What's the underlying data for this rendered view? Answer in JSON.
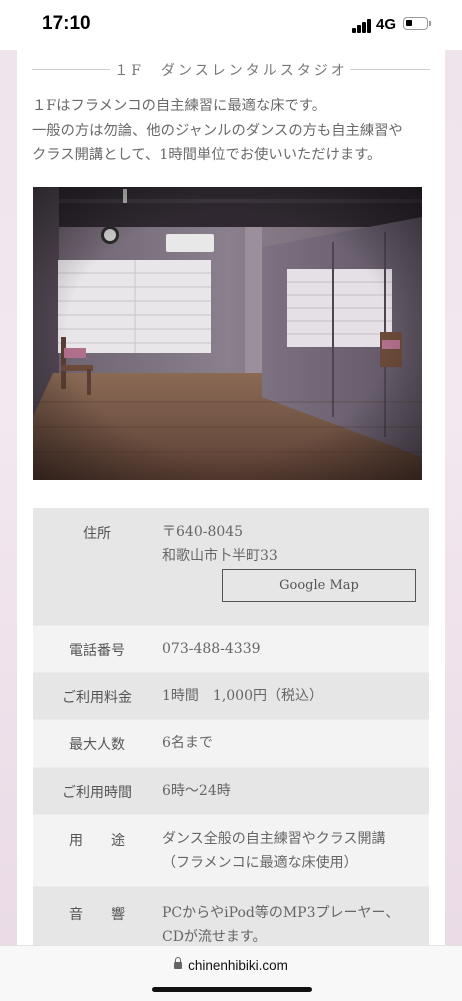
{
  "status_bar": {
    "time": "17:10",
    "network": "4G",
    "battery_level": 0.25
  },
  "section": {
    "heading": "１F　ダンスレンタルスタジオ",
    "intro_lines": [
      "１Fはフラメンコの自主練習に最適な床です。",
      "一般の方は勿論、他のジャンルのダンスの方も自主練習や",
      "クラス開講として、1時間単位でお使いいただけます。"
    ]
  },
  "info": {
    "address": {
      "label": "住所",
      "postal": "〒640-8045",
      "street": "和歌山市卜半町33",
      "map_button": "Google Map"
    },
    "phone": {
      "label": "電話番号",
      "value": "073-488-4339"
    },
    "fee": {
      "label": "ご利用料金",
      "value": "1時間　1,000円（税込）"
    },
    "capacity": {
      "label": "最大人数",
      "value": "6名まで"
    },
    "hours": {
      "label": "ご利用時間",
      "value": "6時～24時"
    },
    "usage": {
      "label": "用　　途",
      "line1": "ダンス全般の自主練習やクラス開講",
      "line2": "（フラメンコに最適な床使用）"
    },
    "audio": {
      "label": "音　　響",
      "line1": "PCからやiPod等のMP3プレーヤー、",
      "line2": "CDが流せます。"
    }
  },
  "browser": {
    "url": "chinenhibiki.com",
    "lock_icon": "lock-icon"
  },
  "colors": {
    "side_band": "#f0e4ed",
    "row_dark": "#e6e6e6",
    "row_light": "#f3f3f3"
  }
}
